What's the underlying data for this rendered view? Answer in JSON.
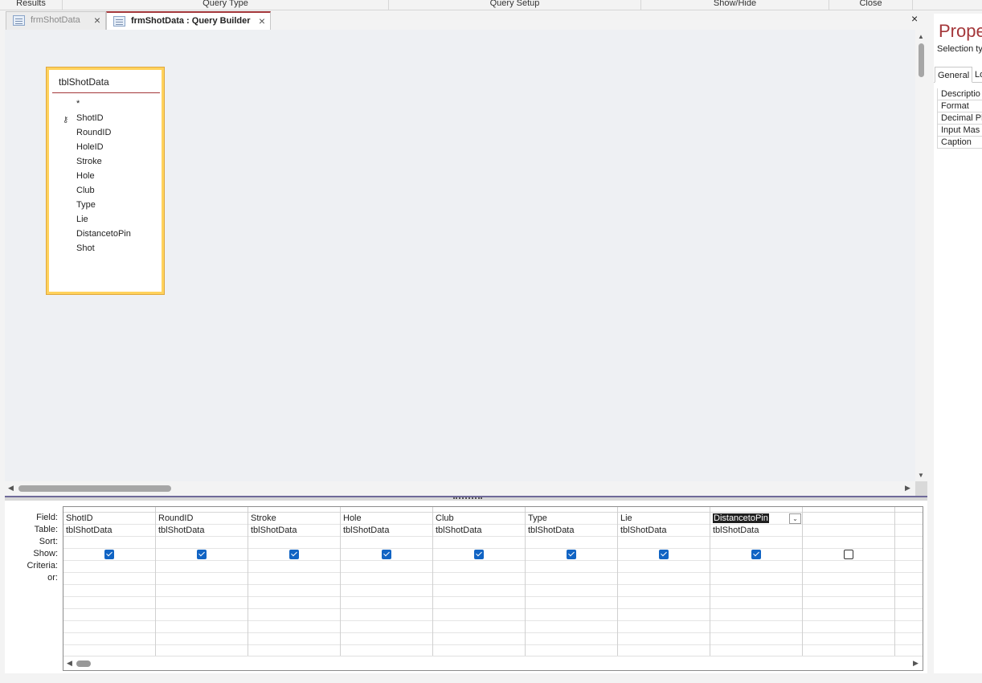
{
  "ribbon": {
    "groups": [
      "Results",
      "Query Type",
      "Query Setup",
      "Show/Hide",
      "Close"
    ]
  },
  "tabs": [
    {
      "label": "frmShotData",
      "active": false
    },
    {
      "label": "frmShotData : Query Builder",
      "active": true
    }
  ],
  "close_glyph": "×",
  "table": {
    "name": "tblShotData",
    "fields": [
      "*",
      "ShotID",
      "RoundID",
      "HoleID",
      "Stroke",
      "Hole",
      "Club",
      "Type",
      "Lie",
      "DistancetoPin",
      "Shot"
    ],
    "primary_key": "ShotID"
  },
  "grid": {
    "row_labels": [
      "Field:",
      "Table:",
      "Sort:",
      "Show:",
      "Criteria:",
      "or:"
    ],
    "columns": [
      {
        "field": "ShotID",
        "table": "tblShotData",
        "show": true
      },
      {
        "field": "RoundID",
        "table": "tblShotData",
        "show": true
      },
      {
        "field": "Stroke",
        "table": "tblShotData",
        "show": true
      },
      {
        "field": "Hole",
        "table": "tblShotData",
        "show": true
      },
      {
        "field": "Club",
        "table": "tblShotData",
        "show": true
      },
      {
        "field": "Type",
        "table": "tblShotData",
        "show": true
      },
      {
        "field": "Lie",
        "table": "tblShotData",
        "show": true
      },
      {
        "field": "DistancetoPin",
        "table": "tblShotData",
        "show": true,
        "selected": true
      },
      {
        "field": "",
        "table": "",
        "show": false
      }
    ]
  },
  "property_sheet": {
    "title": "Prope",
    "selection_type": "Selection ty",
    "tabs": [
      "General",
      "Lo"
    ],
    "rows": [
      "Descriptio",
      "Format",
      "Decimal Pl",
      "Input Mas",
      "Caption"
    ]
  },
  "colors": {
    "accent": "#a4373a",
    "checkbox": "#1164c4",
    "table_border": "#ffd25c"
  }
}
